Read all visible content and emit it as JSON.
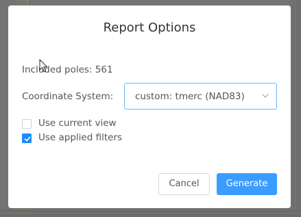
{
  "dialog": {
    "title": "Report Options",
    "included_poles_label": "Included poles:",
    "included_poles_count": "561",
    "coordinate_system_label": "Coordinate System:",
    "coordinate_system_value": "custom: tmerc (NAD83)"
  },
  "options": {
    "use_current_view": {
      "label": "Use current view",
      "checked": false
    },
    "use_applied_filters": {
      "label": "Use applied filters",
      "checked": true
    }
  },
  "buttons": {
    "cancel": "Cancel",
    "generate": "Generate"
  },
  "colors": {
    "accent": "#3b9cff",
    "focus_border": "#6cb4ff",
    "text": "#555555"
  },
  "icons": [
    "chevron-down-icon",
    "checkmark-icon",
    "mouse-pointer-icon"
  ]
}
